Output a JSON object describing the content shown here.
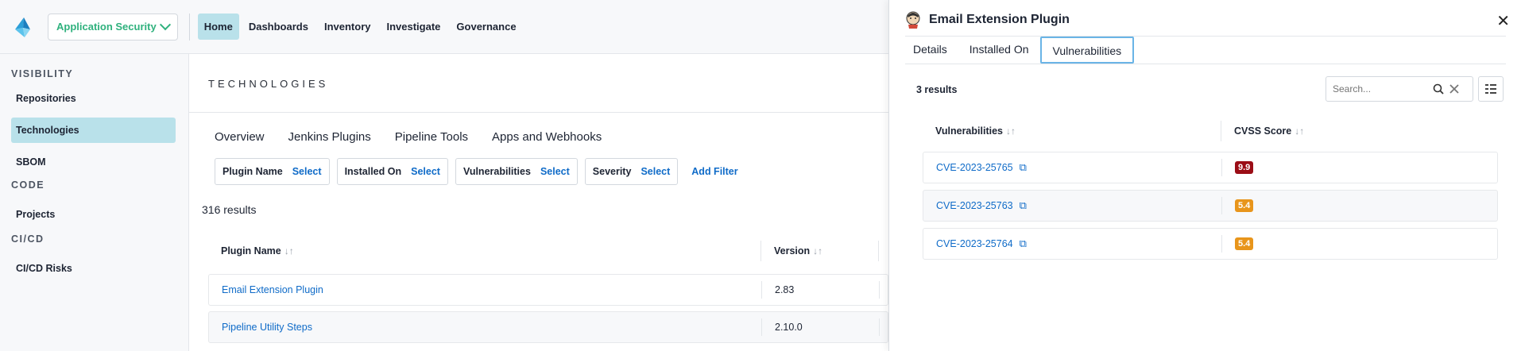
{
  "topbar": {
    "app_switch_label": "Application Security",
    "nav": [
      "Home",
      "Dashboards",
      "Inventory",
      "Investigate",
      "Governance"
    ]
  },
  "sidebar": {
    "sections": [
      {
        "title": "VISIBILITY",
        "items": [
          "Repositories",
          "Technologies",
          "SBOM"
        ]
      },
      {
        "title": "CODE",
        "items": [
          "Projects"
        ]
      },
      {
        "title": "CI/CD",
        "items": [
          "CI/CD Risks"
        ]
      }
    ]
  },
  "main": {
    "title": "TECHNOLOGIES",
    "tabs": [
      "Overview",
      "Jenkins Plugins",
      "Pipeline Tools",
      "Apps and Webhooks"
    ],
    "filters": [
      {
        "label": "Plugin Name",
        "action": "Select"
      },
      {
        "label": "Installed On",
        "action": "Select"
      },
      {
        "label": "Vulnerabilities",
        "action": "Select"
      },
      {
        "label": "Severity",
        "action": "Select"
      }
    ],
    "add_filter": "Add Filter",
    "results": "316 results",
    "columns": [
      "Plugin Name",
      "Version"
    ],
    "rows": [
      {
        "name": "Email Extension Plugin",
        "version": "2.83"
      },
      {
        "name": "Pipeline Utility Steps",
        "version": "2.10.0"
      }
    ]
  },
  "drawer": {
    "title": "Email Extension Plugin",
    "tabs": [
      "Details",
      "Installed On",
      "Vulnerabilities"
    ],
    "active_tab": "Vulnerabilities",
    "results": "3 results",
    "search_placeholder": "Search...",
    "columns": [
      "Vulnerabilities",
      "CVSS Score"
    ],
    "rows": [
      {
        "cve": "CVE-2023-25765",
        "score": "9.9",
        "color": "#9b0d16"
      },
      {
        "cve": "CVE-2023-25763",
        "score": "5.4",
        "color": "#e8951b"
      },
      {
        "cve": "CVE-2023-25764",
        "score": "5.4",
        "color": "#e8951b"
      }
    ]
  },
  "colors": {
    "accent": "#0f6bc8",
    "brand_green": "#2fb17d",
    "active_bg": "#b9e1ea"
  }
}
